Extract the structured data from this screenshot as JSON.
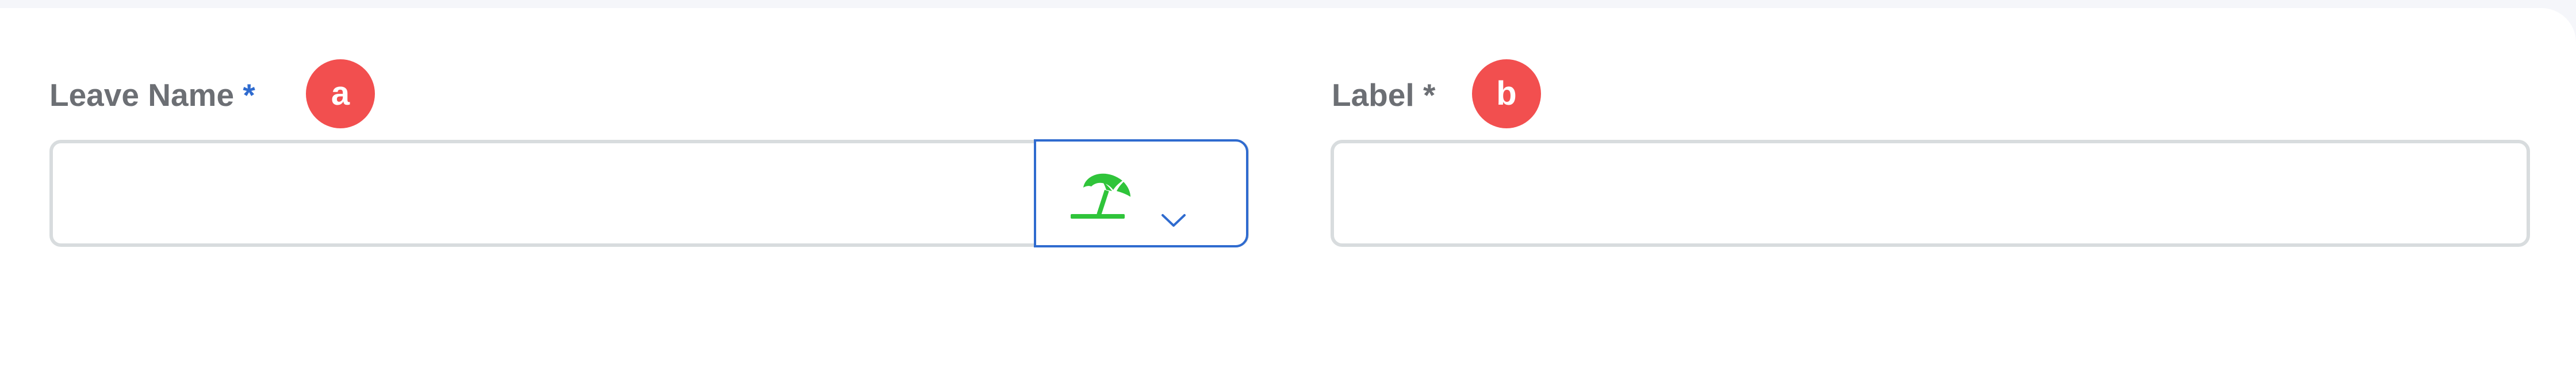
{
  "form": {
    "leave_name": {
      "label": "Leave Name",
      "required_mark": "*",
      "value": "",
      "badge": "a",
      "icon_picker": {
        "selected_icon": "beach-umbrella-icon",
        "icon_color": "#2fc43a",
        "dropdown_icon": "chevron-down-icon"
      }
    },
    "label_field": {
      "label": "Label",
      "required_mark": "*",
      "value": "",
      "badge": "b"
    }
  },
  "colors": {
    "accent": "#2f6bcf",
    "badge": "#f24f4f",
    "icon_green": "#2fc43a",
    "border": "#d8dcde",
    "label_text": "#6c6f74"
  }
}
